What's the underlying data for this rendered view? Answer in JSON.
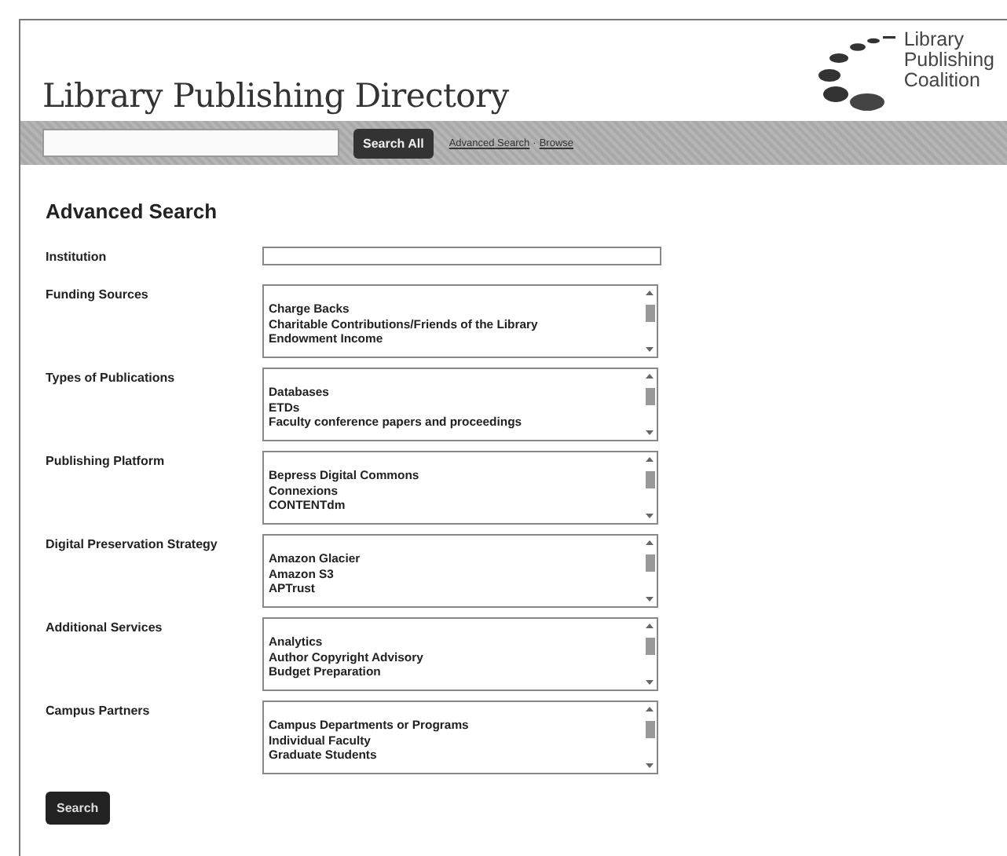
{
  "header": {
    "title": "Library Publishing Directory",
    "logo_text": [
      "Library",
      "Publishing",
      "Coalition"
    ],
    "search_button": "Search All",
    "links": [
      {
        "label": "Advanced Search"
      },
      {
        "label": "Browse"
      }
    ],
    "link_separator": "·"
  },
  "form": {
    "heading": "Advanced Search",
    "fields": [
      {
        "kind": "text",
        "label": "Institution"
      },
      {
        "kind": "list",
        "label": "Funding Sources",
        "options": [
          "Charge Backs",
          "Charitable Contributions/Friends of the Library",
          "Endowment Income"
        ]
      },
      {
        "kind": "list",
        "label": "Types of Publications",
        "options": [
          "Databases",
          "ETDs",
          "Faculty conference papers and proceedings"
        ]
      },
      {
        "kind": "list",
        "label": "Publishing Platform",
        "options": [
          "Bepress Digital Commons",
          "Connexions",
          "CONTENTdm"
        ]
      },
      {
        "kind": "list",
        "label": "Digital Preservation Strategy",
        "options": [
          "Amazon Glacier",
          "Amazon S3",
          "APTrust"
        ]
      },
      {
        "kind": "list",
        "label": "Additional Services",
        "options": [
          "Analytics",
          "Author Copyright Advisory",
          "Budget Preparation"
        ]
      },
      {
        "kind": "list",
        "label": "Campus Partners",
        "options": [
          "Campus Departments or Programs",
          "Individual Faculty",
          "Graduate Students"
        ]
      }
    ],
    "submit": "Search"
  }
}
